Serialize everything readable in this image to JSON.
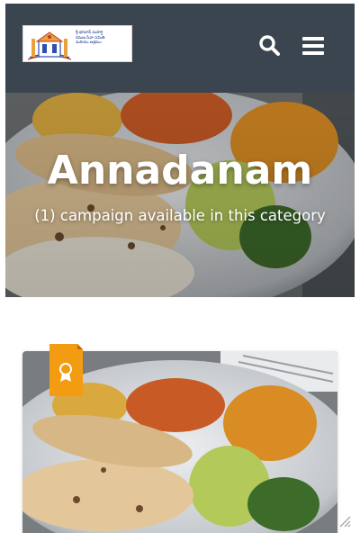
{
  "header": {
    "logo_lines": [
      "శ్రీ భగవాన్ మహర్షి",
      "రమణ సేవా సమితి",
      "మరియు ఆశ్రమం"
    ],
    "search_icon": "search-icon",
    "menu_icon": "hamburger-menu-icon",
    "background": "#3b4550"
  },
  "hero": {
    "title": "Annadanam",
    "subtitle": "(1) campaign available in this category"
  },
  "campaign_card": {
    "badge_icon": "award-ribbon-icon",
    "badge_color": "#f39c12"
  }
}
